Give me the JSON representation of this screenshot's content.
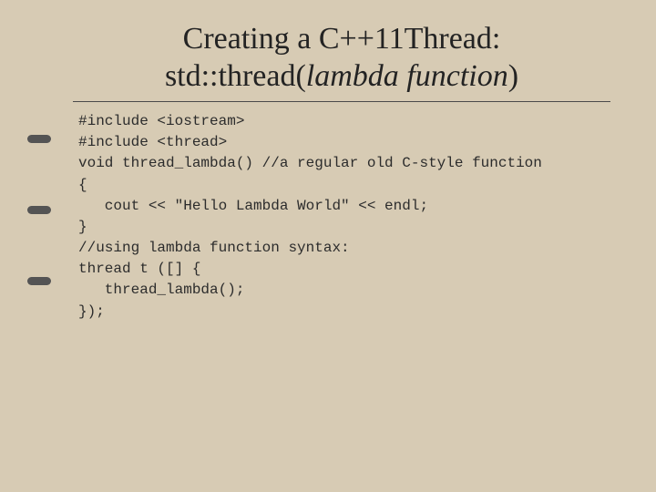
{
  "title": {
    "line1": "Creating a C++11Thread:",
    "line2_prefix": "std::thread(",
    "line2_italic": "lambda function",
    "line2_suffix": ")"
  },
  "code": {
    "l1": "#include <iostream>",
    "l2": "#include <thread>",
    "l3": "void thread_lambda() //a regular old C-style function",
    "l4": "{",
    "l5": "   cout << \"Hello Lambda World\" << endl;",
    "l6": "}",
    "l7": "//using lambda function syntax:",
    "l8": "thread t ([] {",
    "l9": "   thread_lambda();",
    "l10": "});"
  }
}
